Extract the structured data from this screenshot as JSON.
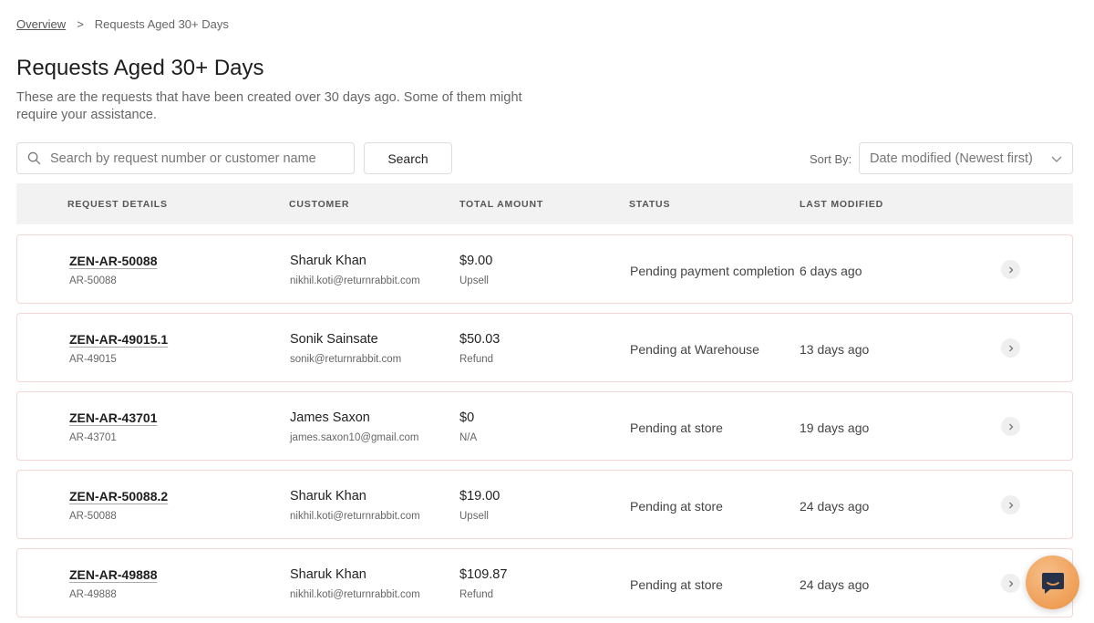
{
  "breadcrumb": {
    "parent": "Overview",
    "separator": ">",
    "current": "Requests Aged 30+ Days"
  },
  "page": {
    "title": "Requests Aged 30+ Days",
    "description": "These are the requests that have been created over 30 days ago. Some of them might require your assistance."
  },
  "search": {
    "placeholder": "Search by request number or customer name",
    "value": "",
    "button_label": "Search"
  },
  "sort": {
    "label": "Sort By:",
    "selected": "Date modified (Newest first)"
  },
  "table": {
    "columns": [
      "REQUEST DETAILS",
      "CUSTOMER",
      "TOTAL AMOUNT",
      "STATUS",
      "LAST MODIFIED"
    ],
    "rows": [
      {
        "request_id": "ZEN-AR-50088",
        "request_ref": "AR-50088",
        "customer_name": "Sharuk Khan",
        "customer_email": "nikhil.koti@returnrabbit.com",
        "amount": "$9.00",
        "amount_type": "Upsell",
        "status": "Pending payment completion",
        "last_modified": "6 days ago"
      },
      {
        "request_id": "ZEN-AR-49015.1",
        "request_ref": "AR-49015",
        "customer_name": "Sonik Sainsate",
        "customer_email": "sonik@returnrabbit.com",
        "amount": "$50.03",
        "amount_type": "Refund",
        "status": "Pending at Warehouse",
        "last_modified": "13 days ago"
      },
      {
        "request_id": "ZEN-AR-43701",
        "request_ref": "AR-43701",
        "customer_name": "James Saxon",
        "customer_email": "james.saxon10@gmail.com",
        "amount": "$0",
        "amount_type": "N/A",
        "status": "Pending at store",
        "last_modified": "19 days ago"
      },
      {
        "request_id": "ZEN-AR-50088.2",
        "request_ref": "AR-50088",
        "customer_name": "Sharuk Khan",
        "customer_email": "nikhil.koti@returnrabbit.com",
        "amount": "$19.00",
        "amount_type": "Upsell",
        "status": "Pending at store",
        "last_modified": "24 days ago"
      },
      {
        "request_id": "ZEN-AR-49888",
        "request_ref": "AR-49888",
        "customer_name": "Sharuk Khan",
        "customer_email": "nikhil.koti@returnrabbit.com",
        "amount": "$109.87",
        "amount_type": "Refund",
        "status": "Pending at store",
        "last_modified": "24 days ago"
      }
    ]
  },
  "icons": {
    "search": "search-icon",
    "sort_chevron": "chevron-down-icon",
    "row_chevron": "chevron-right-icon",
    "chat": "chat-bubble-icon"
  },
  "colors": {
    "row_border": "#f5d6d6",
    "header_bg": "#f2f2f2",
    "chat_accent": "#ef9e55"
  }
}
